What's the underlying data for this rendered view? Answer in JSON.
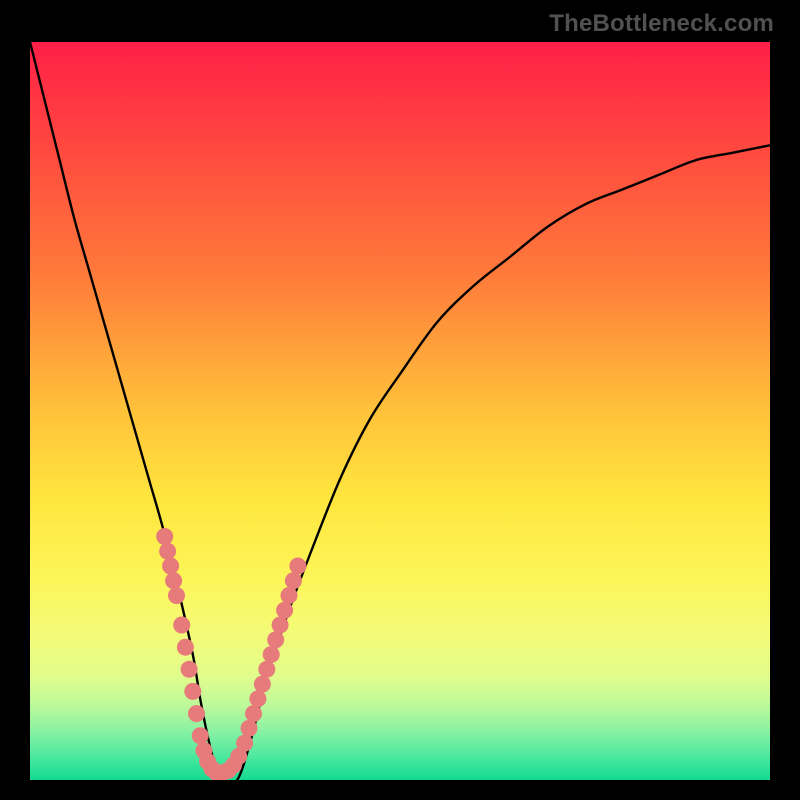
{
  "watermark": {
    "text": "TheBottleneck.com"
  },
  "chart_data": {
    "type": "line",
    "title": "",
    "xlabel": "",
    "ylabel": "",
    "xlim": [
      0,
      100
    ],
    "ylim": [
      0,
      100
    ],
    "grid": false,
    "legend": false,
    "series": [
      {
        "name": "bottleneck-curve",
        "color": "#000000",
        "x": [
          0,
          2,
          4,
          6,
          8,
          10,
          12,
          14,
          16,
          18,
          20,
          22,
          23,
          24,
          25,
          26,
          28,
          30,
          32,
          35,
          38,
          42,
          46,
          50,
          55,
          60,
          65,
          70,
          75,
          80,
          85,
          90,
          95,
          100
        ],
        "y": [
          100,
          92,
          84,
          76,
          69,
          62,
          55,
          48,
          41,
          34,
          26,
          17,
          11,
          6,
          2,
          0,
          0,
          6,
          14,
          23,
          31,
          41,
          49,
          55,
          62,
          67,
          71,
          75,
          78,
          80,
          82,
          84,
          85,
          86
        ]
      }
    ],
    "annotations_scatter": {
      "name": "highlight-dots",
      "color": "#E77B7B",
      "points_xy": [
        [
          18.2,
          33
        ],
        [
          18.6,
          31
        ],
        [
          19.0,
          29
        ],
        [
          19.4,
          27
        ],
        [
          19.8,
          25
        ],
        [
          20.5,
          21
        ],
        [
          21.0,
          18
        ],
        [
          21.5,
          15
        ],
        [
          22.0,
          12
        ],
        [
          22.5,
          9
        ],
        [
          23.0,
          6
        ],
        [
          23.5,
          4
        ],
        [
          24.0,
          2.5
        ],
        [
          24.6,
          1.5
        ],
        [
          25.2,
          1
        ],
        [
          26.0,
          1
        ],
        [
          26.8,
          1.3
        ],
        [
          27.5,
          2
        ],
        [
          28.2,
          3.2
        ],
        [
          29.0,
          5
        ],
        [
          29.6,
          7
        ],
        [
          30.2,
          9
        ],
        [
          30.8,
          11
        ],
        [
          31.4,
          13
        ],
        [
          32.0,
          15
        ],
        [
          32.6,
          17
        ],
        [
          33.2,
          19
        ],
        [
          33.8,
          21
        ],
        [
          34.4,
          23
        ],
        [
          35.0,
          25
        ],
        [
          35.6,
          27
        ],
        [
          36.2,
          29
        ]
      ]
    },
    "gradient_stops": [
      {
        "pos": 0.0,
        "color": "#FF1F47"
      },
      {
        "pos": 0.15,
        "color": "#FF4A3F"
      },
      {
        "pos": 0.32,
        "color": "#FF7C3A"
      },
      {
        "pos": 0.5,
        "color": "#FFC23A"
      },
      {
        "pos": 0.62,
        "color": "#FFE63E"
      },
      {
        "pos": 0.73,
        "color": "#FCF65A"
      },
      {
        "pos": 0.8,
        "color": "#F4FB77"
      },
      {
        "pos": 0.86,
        "color": "#E1FC8C"
      },
      {
        "pos": 0.9,
        "color": "#BCF99B"
      },
      {
        "pos": 0.93,
        "color": "#8EF3A2"
      },
      {
        "pos": 0.96,
        "color": "#5CEBA0"
      },
      {
        "pos": 0.985,
        "color": "#2BE298"
      },
      {
        "pos": 1.0,
        "color": "#14D98F"
      }
    ]
  }
}
